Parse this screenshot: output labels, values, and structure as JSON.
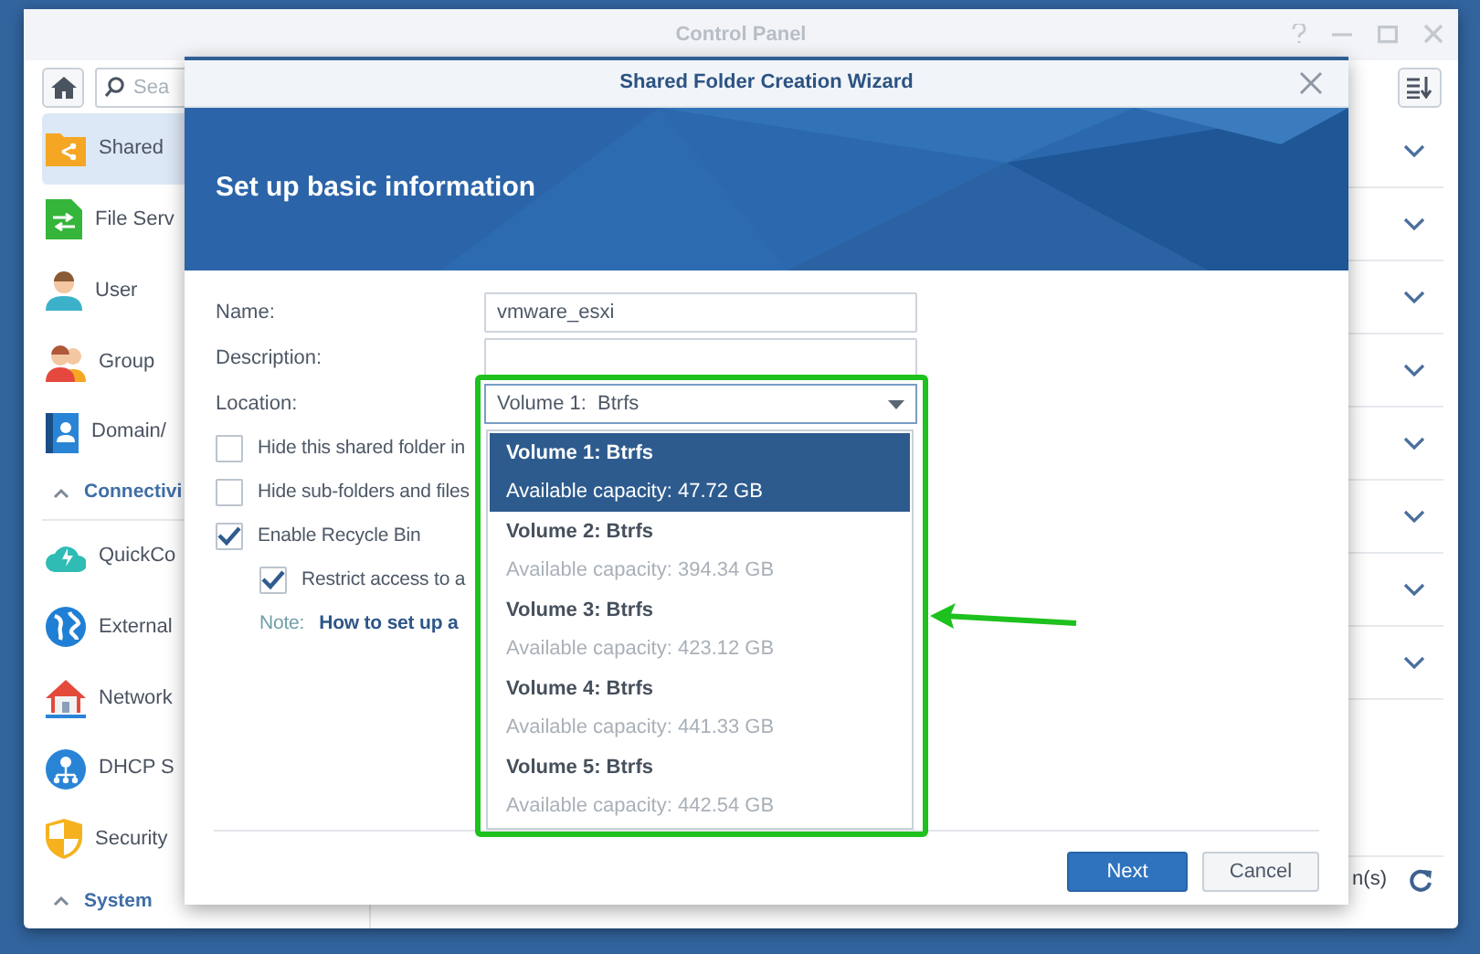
{
  "window": {
    "title": "Control Panel"
  },
  "sidebar": {
    "search": {
      "placeholder": "Sea"
    },
    "items": [
      {
        "kind": "item",
        "label": "Shared",
        "selected": true
      },
      {
        "kind": "item",
        "label": "File Serv",
        "selected": false
      },
      {
        "kind": "item",
        "label": "User",
        "selected": false
      },
      {
        "kind": "item",
        "label": "Group",
        "selected": false
      },
      {
        "kind": "item",
        "label": "Domain/",
        "selected": false
      },
      {
        "kind": "section",
        "label": "Connectivi",
        "expanded": true
      },
      {
        "kind": "item",
        "label": "QuickCo",
        "selected": false
      },
      {
        "kind": "item",
        "label": "External",
        "selected": false
      },
      {
        "kind": "item",
        "label": "Network",
        "selected": false
      },
      {
        "kind": "item",
        "label": "DHCP S",
        "selected": false
      },
      {
        "kind": "item",
        "label": "Security",
        "selected": false
      },
      {
        "kind": "section",
        "label": "System",
        "expanded": true
      }
    ]
  },
  "status_bar": {
    "text": "n(s)"
  },
  "dialog": {
    "title": "Shared Folder Creation Wizard",
    "heading": "Set up basic information",
    "fields": [
      {
        "kind": "text",
        "label": "Name:",
        "value": "vmware_esxi"
      },
      {
        "kind": "text",
        "label": "Description:"
      },
      {
        "kind": "select",
        "label": "Location:",
        "value": "Volume 1:  Btrfs"
      }
    ],
    "options": [
      {
        "label": "Hide this shared folder in",
        "checked": false
      },
      {
        "label": "Hide sub-folders and files",
        "checked": false
      },
      {
        "label": "Enable Recycle Bin",
        "checked": true,
        "children": [
          {
            "label": "Restrict access to a",
            "checked": true
          }
        ]
      }
    ],
    "note": {
      "label": "Note:",
      "link": "How to set up a"
    },
    "dropdown": [
      {
        "name": "Volume 1: Btrfs",
        "capacity": "Available capacity: 47.72 GB",
        "selected": true
      },
      {
        "name": "Volume 2: Btrfs",
        "capacity": "Available capacity: 394.34 GB",
        "selected": false
      },
      {
        "name": "Volume 3: Btrfs",
        "capacity": "Available capacity: 423.12 GB",
        "selected": false
      },
      {
        "name": "Volume 4: Btrfs",
        "capacity": "Available capacity: 441.33 GB",
        "selected": false
      },
      {
        "name": "Volume 5: Btrfs",
        "capacity": "Available capacity: 442.54 GB",
        "selected": false
      }
    ],
    "buttons": [
      {
        "kind": "primary",
        "label": "Next"
      },
      {
        "kind": "secondary",
        "label": "Cancel"
      }
    ]
  }
}
